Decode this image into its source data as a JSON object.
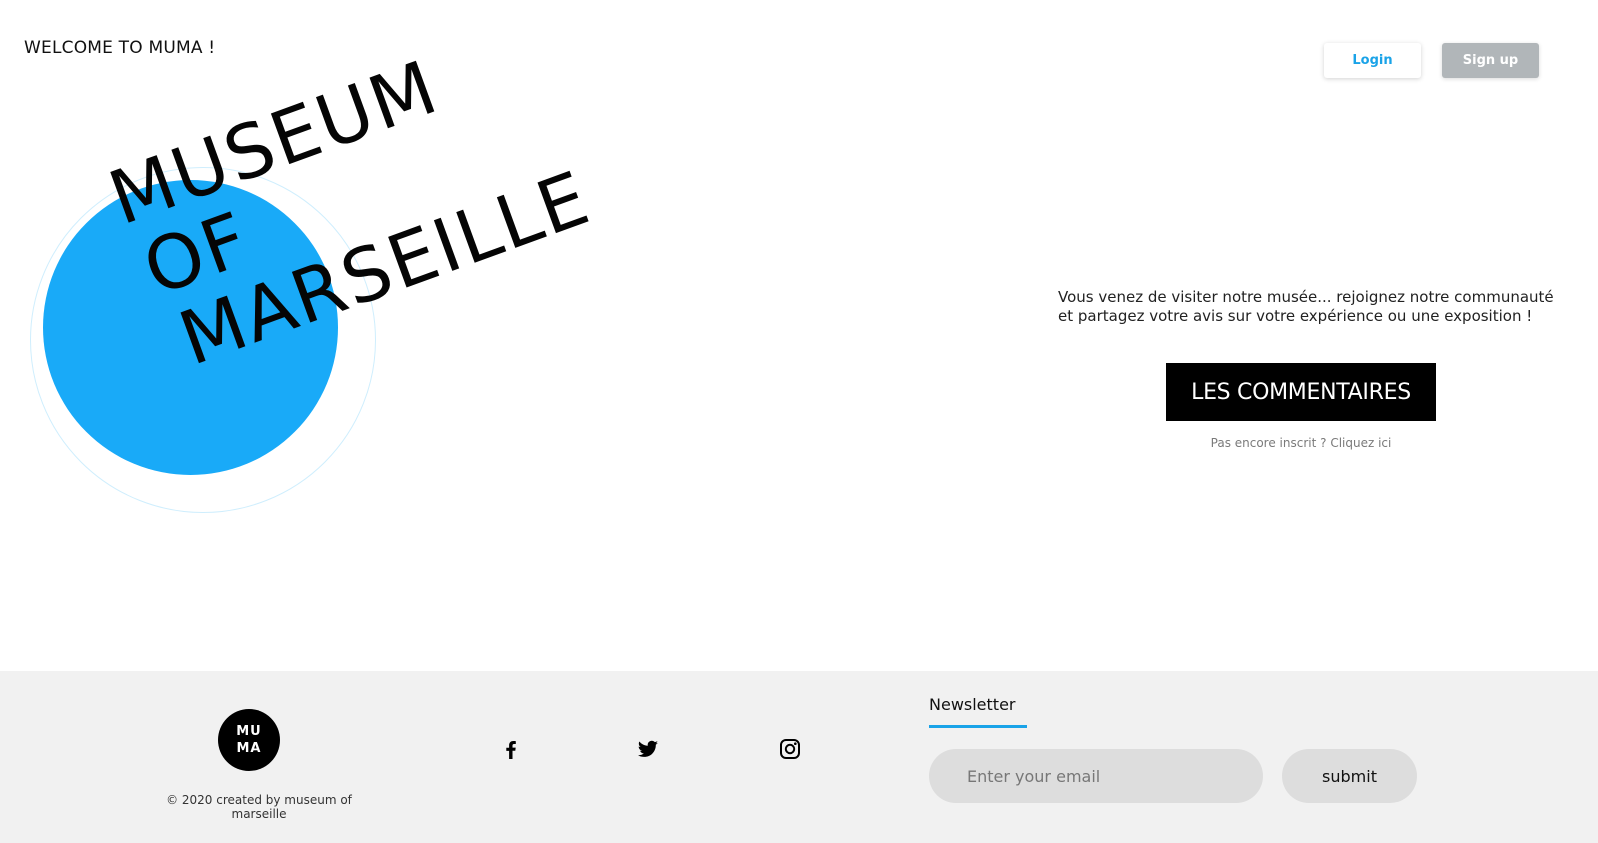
{
  "header": {
    "welcome_text": "WELCOME TO MUMA !",
    "login_label": "Login",
    "signup_label": "Sign up"
  },
  "hero": {
    "title_lines": [
      "MUSEUM",
      "OF",
      "MARSEILLE"
    ],
    "circle_color": "#19aaf8"
  },
  "main": {
    "intro_text": "Vous venez de visiter notre musée... rejoignez notre communauté et partagez votre avis sur votre expérience ou une exposition !",
    "comments_button": "LES COMMENTAIRES",
    "register_link": "Pas encore inscrit ? Cliquez ici"
  },
  "footer": {
    "logo_lines": [
      "MU",
      "MA"
    ],
    "copyright": "© 2020 created by museum of marseille",
    "social": [
      "facebook-icon",
      "twitter-icon",
      "instagram-icon"
    ],
    "newsletter_title": "Newsletter",
    "email_placeholder": "Enter your email",
    "submit_label": "submit"
  },
  "colors": {
    "accent": "#1aa3e8",
    "footer_bg": "#f1f1f1",
    "signup_bg": "#b1b6b9"
  }
}
